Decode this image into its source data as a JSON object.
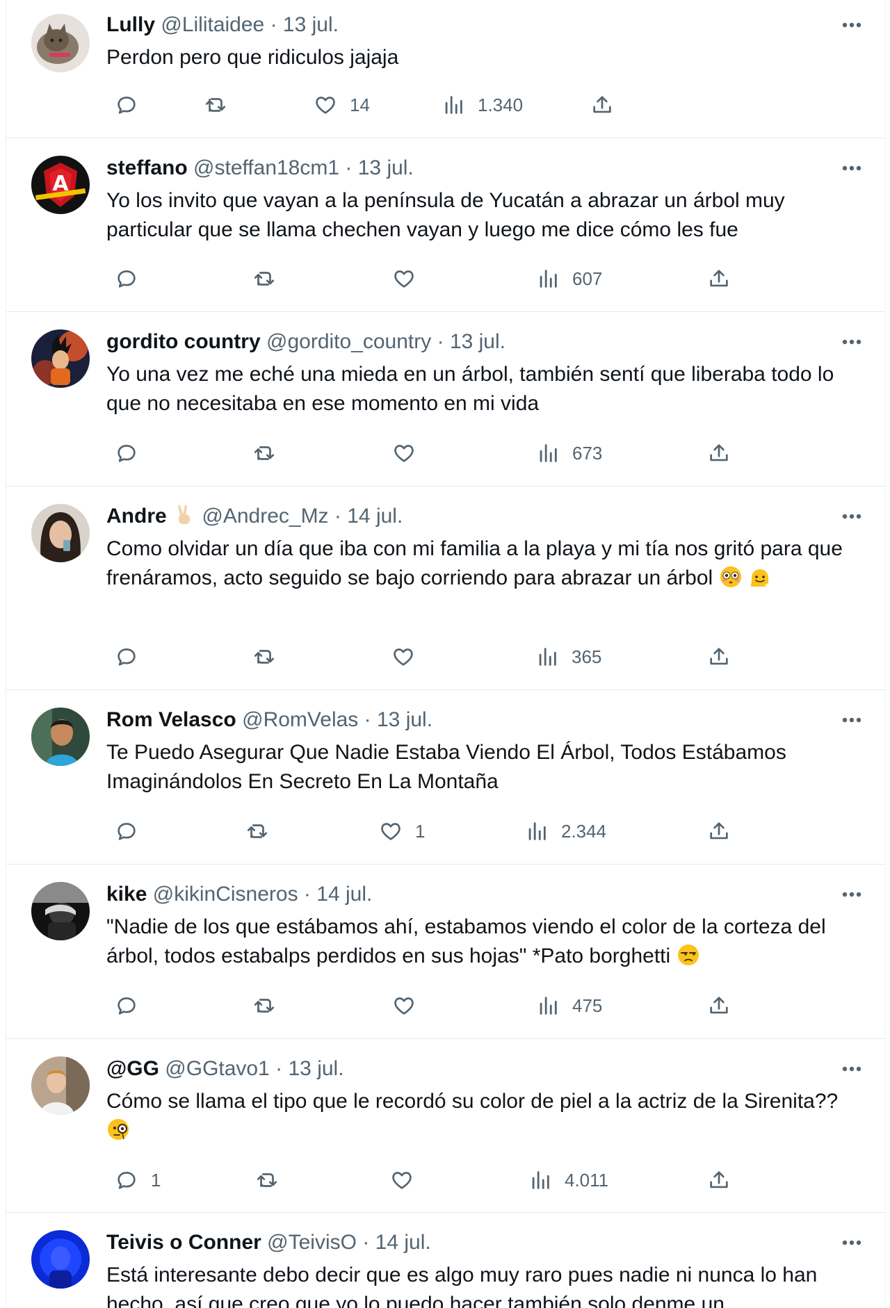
{
  "tweets": [
    {
      "name": "Lully",
      "handle": "@Lilitaidee",
      "date": "13 jul.",
      "text": "Perdon pero que ridiculos jajaja",
      "replies": "",
      "retweets": "",
      "likes": "14",
      "views": "1.340"
    },
    {
      "name": "steffano",
      "handle": "@steffan18cm1",
      "date": "13 jul.",
      "text": "Yo los invito que vayan a la península de Yucatán a abrazar un árbol muy particular que se llama chechen vayan y luego me dice cómo les fue",
      "replies": "",
      "retweets": "",
      "likes": "",
      "views": "607"
    },
    {
      "name": "gordito country",
      "handle": "@gordito_country",
      "date": "13 jul.",
      "text": "Yo una vez me eché una mieda en un árbol, también sentí que liberaba todo lo que no necesitaba en ese momento en mi vida",
      "replies": "",
      "retweets": "",
      "likes": "",
      "views": "673"
    },
    {
      "name": "Andre",
      "handle": "@Andrec_Mz",
      "date": "14 jul.",
      "text": "Como olvidar un día que iba con mi familia a la playa y mi tía nos gritó para que frenáramos, acto seguido se bajo corriendo para abrazar un árbol",
      "replies": "",
      "retweets": "",
      "likes": "",
      "views": "365"
    },
    {
      "name": "Rom Velasco",
      "handle": "@RomVelas",
      "date": "13 jul.",
      "text": "Te Puedo Asegurar Que Nadie Estaba Viendo El Árbol, Todos Estábamos Imaginándolos En Secreto En La Montaña",
      "replies": "",
      "retweets": "",
      "likes": "1",
      "views": "2.344"
    },
    {
      "name": "kike",
      "handle": "@kikinCisneros",
      "date": "14 jul.",
      "text": "\"Nadie de los que estábamos ahí, estabamos viendo el color de la corteza del árbol, todos estabalps perdidos en sus hojas\" *Pato borghetti",
      "replies": "",
      "retweets": "",
      "likes": "",
      "views": "475"
    },
    {
      "name": "@GG",
      "handle": "@GGtavo1",
      "date": "13 jul.",
      "text": "Cómo se llama el tipo que le recordó su color de piel a la actriz de la Sirenita??",
      "replies": "1",
      "retweets": "",
      "likes": "",
      "views": "4.011"
    },
    {
      "name": "Teivis o Conner",
      "handle": "@TeivisO",
      "date": "14 jul.",
      "text": "Está interesante debo decir que es algo muy raro pues nadie ni nunca lo han hecho, así que creo que yo lo puedo hacer también solo denme un",
      "replies": "",
      "retweets": "",
      "likes": "",
      "views": ""
    }
  ],
  "separator": "·",
  "icons": {
    "reply": "reply-icon",
    "retweet": "retweet-icon",
    "like": "like-icon",
    "views": "views-icon",
    "share": "share-icon",
    "more": "more-icon",
    "emojis": [
      "victory-hand-emoji",
      "flushed-face-emoji",
      "melting-face-emoji",
      "unamused-face-emoji",
      "face-with-monocle-emoji"
    ]
  },
  "colors": {
    "text": "#0f1419",
    "secondary": "#536471",
    "divider": "#e7e9ea"
  }
}
